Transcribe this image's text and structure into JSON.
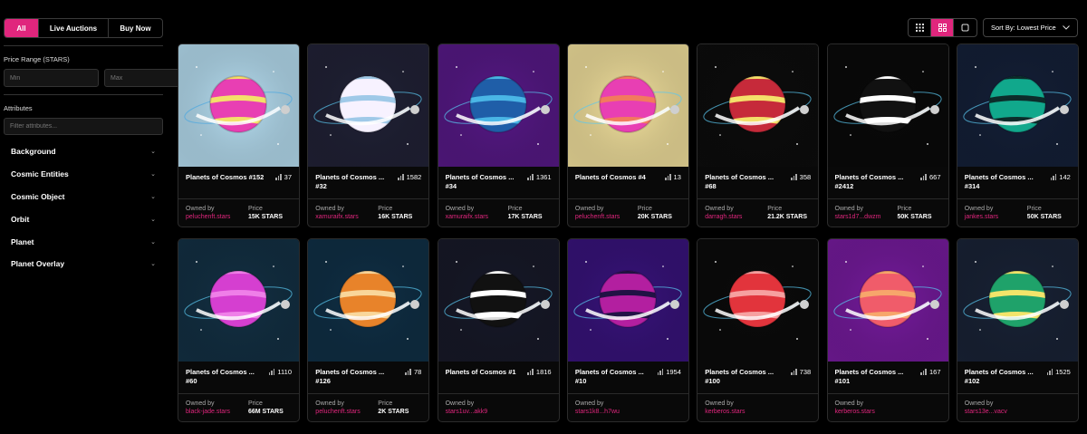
{
  "filters": {
    "tabs": [
      "All",
      "Live Auctions",
      "Buy Now"
    ],
    "active_tab": "All"
  },
  "price_range": {
    "label": "Price Range (STARS)",
    "min_placeholder": "Min",
    "max_placeholder": "Max"
  },
  "attributes": {
    "label": "Attributes",
    "filter_placeholder": "Filter attributes...",
    "items": [
      "Background",
      "Cosmic Entities",
      "Cosmic Object",
      "Orbit",
      "Planet",
      "Planet Overlay"
    ]
  },
  "sort": {
    "label": "Sort By: Lowest Price"
  },
  "card_labels": {
    "owned_by": "Owned by",
    "price": "Price"
  },
  "cards": [
    {
      "name": "Planets of Cosmos #152",
      "name_display": "Planets of Cosmos #152",
      "number": "",
      "views": "37",
      "owner": "peluchenft.stars",
      "price": "15K STARS",
      "bg": "#bde6fa",
      "planet": [
        "#e83fb3",
        "#f4e06a"
      ],
      "ring": true
    },
    {
      "name": "Planets of Cosmos #32",
      "name_display": "Planets of Cosmos ...",
      "number": "#32",
      "views": "1582",
      "owner": "xamuraifx.stars",
      "price": "16K STARS",
      "bg": "#222338",
      "planet": [
        "#f7f2ff",
        "#9fc9e8"
      ],
      "ring": true
    },
    {
      "name": "Planets of Cosmos #34",
      "name_display": "Planets of Cosmos ...",
      "number": "#34",
      "views": "1361",
      "owner": "xamuraifx.stars",
      "price": "17K STARS",
      "bg": "#5a1a8c",
      "planet": [
        "#1f5ea8",
        "#4ab6e6"
      ],
      "ring": true
    },
    {
      "name": "Planets of Cosmos #4",
      "name_display": "Planets of Cosmos #4",
      "number": "",
      "views": "13",
      "owner": "peluchenft.stars",
      "price": "20K STARS",
      "bg": "#fbe9a3",
      "planet": [
        "#e83fb3",
        "#f27a5e"
      ],
      "ring": true
    },
    {
      "name": "Planets of Cosmos #68",
      "name_display": "Planets of Cosmos ...",
      "number": "#68",
      "views": "358",
      "owner": "darragh.stars",
      "price": "21.2K STARS",
      "bg": "#0d0d0d",
      "planet": [
        "#c62a3a",
        "#f4e06a"
      ],
      "ring": true
    },
    {
      "name": "Planets of Cosmos #2412",
      "name_display": "Planets of Cosmos ...",
      "number": "#2412",
      "views": "667",
      "owner": "stars1d7...dwzm",
      "price": "50K STARS",
      "bg": "#0a0a0a",
      "planet": [
        "#111111",
        "#ffffff"
      ],
      "ring": true
    },
    {
      "name": "Planets of Cosmos #314",
      "name_display": "Planets of Cosmos ...",
      "number": "#314",
      "views": "142",
      "owner": "jankes.stars",
      "price": "50K STARS",
      "bg": "#15213a",
      "planet": [
        "#11a88c",
        "#0c2c2a"
      ],
      "ring": true
    },
    {
      "name": "Planets of Cosmos #60",
      "name_display": "Planets of Cosmos ...",
      "number": "#60",
      "views": "1110",
      "owner": "black-jade.stars",
      "price": "66M STARS",
      "bg": "#143246",
      "planet": [
        "#d53fd0",
        "#ef7fe8"
      ],
      "ring": true
    },
    {
      "name": "Planets of Cosmos #126",
      "name_display": "Planets of Cosmos ... #126",
      "number": "",
      "views": "78",
      "owner": "peluchenft.stars",
      "price": "2K STARS",
      "bg": "#103148",
      "planet": [
        "#e8832a",
        "#f9d69a"
      ],
      "ring": true
    },
    {
      "name": "Planets of Cosmos #1",
      "name_display": "Planets of Cosmos #1",
      "number": "",
      "views": "1816",
      "owner": "stars1uv...akk9",
      "price": "",
      "bg": "#181a2a",
      "planet": [
        "#111111",
        "#ffffff"
      ],
      "ring": true
    },
    {
      "name": "Planets of Cosmos #10",
      "name_display": "Planets of Cosmos ...",
      "number": "#10",
      "views": "1954",
      "owner": "stars1k8...h7wu",
      "price": "",
      "bg": "#3a1480",
      "planet": [
        "#b31fa0",
        "#221245"
      ],
      "ring": true
    },
    {
      "name": "Planets of Cosmos #100",
      "name_display": "Planets of Cosmos ...",
      "number": "#100",
      "views": "738",
      "owner": "kerberos.stars",
      "price": "",
      "bg": "#0b0b0b",
      "planet": [
        "#e2343c",
        "#f6a0a0"
      ],
      "ring": true
    },
    {
      "name": "Planets of Cosmos #101",
      "name_display": "Planets of Cosmos ...",
      "number": "#101",
      "views": "167",
      "owner": "kerberos.stars",
      "price": "",
      "bg": "#7a1ca3",
      "planet": [
        "#f05c6a",
        "#f7a66b"
      ],
      "ring": true
    },
    {
      "name": "Planets of Cosmos #102",
      "name_display": "Planets of Cosmos ...",
      "number": "#102",
      "views": "1525",
      "owner": "stars13e...vacv",
      "price": "",
      "bg": "#1a2438",
      "planet": [
        "#1fa26a",
        "#f2e46a"
      ],
      "ring": true
    }
  ],
  "colors": {
    "accent": "#e0267d",
    "background": "#000000",
    "card_border": "#2c2c2c"
  }
}
